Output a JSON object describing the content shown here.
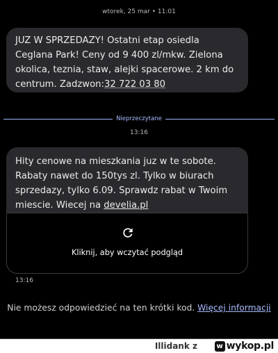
{
  "date_separator": "wtorek, 25 mar • 11:01",
  "message1": {
    "text": "JUZ W SPRZEDAZY! Ostatni etap osiedla Ceglana Park! Ceny od 9 400 zl/mkw. Zielona okolica, teznia, staw, alejki spacerowe. 2 km do centrum. Zadzwon:",
    "phone": "32 722 03 80"
  },
  "unread_label": "Nieprzeczytane",
  "time_center": "13:16",
  "message2": {
    "text": "Hity cenowe na mieszkania juz w te sobote. Rabaty nawet do 150tys zl. Tylko w biurach sprzedazy, tylko 6.09. Sprawdz rabat w Twoim miescie. Wiecej na ",
    "link": "develia.pl",
    "preview_icon": "refresh-icon",
    "preview_text": "Kliknij, aby wczytać podgląd"
  },
  "time_left": "13:16",
  "notice": {
    "text": "Nie możesz odpowiedzieć na ten krótki kod. ",
    "link": "Więcej informacji"
  },
  "footer": {
    "user": "Illidank",
    "suffix": "z",
    "logo_mark": "w",
    "logo_text": "wykop.pl"
  },
  "colors": {
    "background": "#000000",
    "bubble": "#2a2a2e",
    "accent": "#a9bbff"
  }
}
